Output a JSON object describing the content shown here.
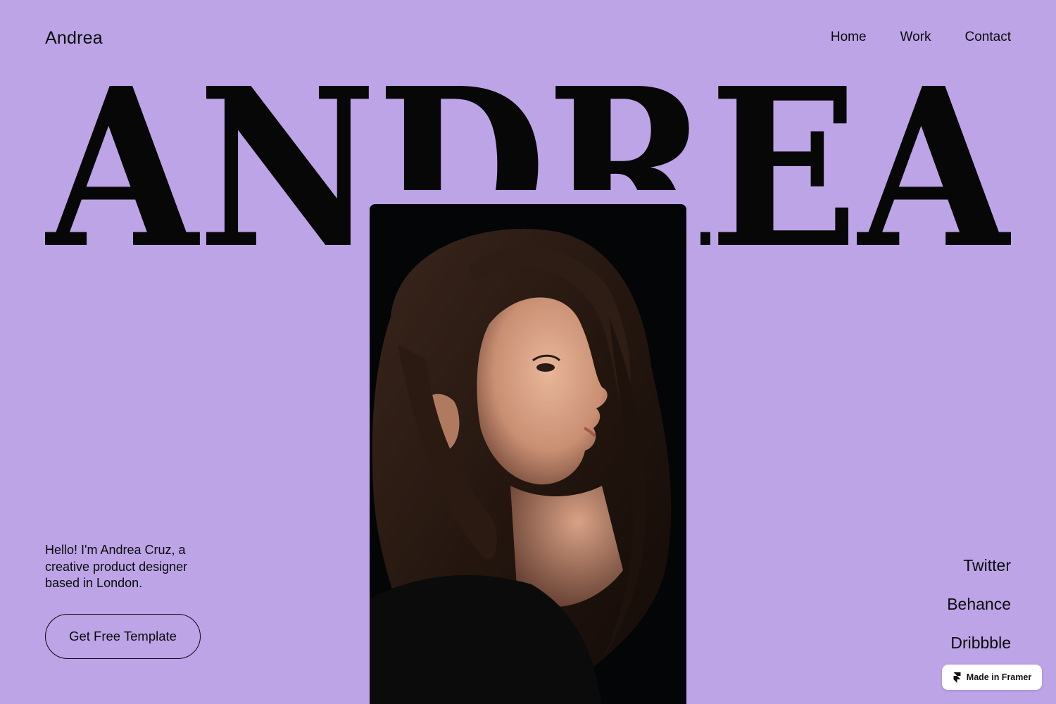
{
  "header": {
    "logo": "Andrea",
    "nav": [
      {
        "label": "Home"
      },
      {
        "label": "Work"
      },
      {
        "label": "Contact"
      }
    ]
  },
  "hero": {
    "word": "ANDREA",
    "photo_alt": "Portrait of a woman in profile against a dark background"
  },
  "intro": {
    "text": "Hello! I'm Andrea Cruz, a creative product designer based in London."
  },
  "cta": {
    "label": "Get Free Template"
  },
  "socials": [
    {
      "label": "Twitter"
    },
    {
      "label": "Behance"
    },
    {
      "label": "Dribbble"
    }
  ],
  "badge": {
    "label": "Made in Framer",
    "icon": "framer-logo-icon"
  },
  "colors": {
    "background": "#bca4e7",
    "text": "#0a0a0a",
    "photo_background": "#030506",
    "badge_background": "#ffffff"
  }
}
